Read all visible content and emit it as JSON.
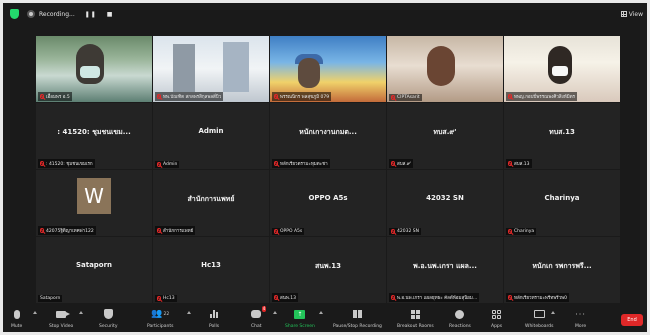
{
  "topbar": {
    "recording_label": "Recording...",
    "pause_label": "❚❚",
    "stop_label": "■",
    "view_label": "View"
  },
  "tiles": [
    {
      "name": "",
      "label": "เอื้อมพร อ.5",
      "muted": true
    },
    {
      "name": "",
      "label": "ทพ.บัณฑิต สกลพรสิกุลพลสี่บิว",
      "muted": true
    },
    {
      "name": "",
      "label": "พรรณนิกร พลสุขภูมิ 079",
      "muted": true
    },
    {
      "name": "",
      "label": "CIPTAsarit",
      "muted": true
    },
    {
      "name": "",
      "label": "ทพญ.กอบปี่พรรณพงศิวสิงห์มิตร",
      "muted": true
    },
    {
      "name": ": 41520: ชุมชนเขม...",
      "label": ": 41520: ชุมชนเขมเรก",
      "muted": true
    },
    {
      "name": "Admin",
      "label": "Admin",
      "muted": true
    },
    {
      "name": "หนักเกางานกมต...",
      "label": "หลักเรียวตรามะทุมตะชา",
      "muted": true
    },
    {
      "name": "ทบส.๙'",
      "label": "สบส.๙'",
      "muted": true
    },
    {
      "name": "ทบส.13",
      "label": "สบส.13",
      "muted": true
    },
    {
      "name": "",
      "label": "42075ฐิติญาเทคพ่า122",
      "muted": true,
      "avatar": "W"
    },
    {
      "name": "สำนักการแพทย์",
      "label": "สำนักการแพทย์",
      "muted": true
    },
    {
      "name": "OPPO A5s",
      "label": "OPPO A5s",
      "muted": true
    },
    {
      "name": "42032 SN",
      "label": "42032 SN",
      "muted": true
    },
    {
      "name": "Charinya",
      "label": "Charinya",
      "muted": true
    },
    {
      "name": "Sataporn",
      "label": "Sataporn",
      "muted": false
    },
    {
      "name": "Hc13",
      "label": "Hc13",
      "muted": true
    },
    {
      "name": "สนพ.13",
      "label": "สนพ.13",
      "muted": true
    },
    {
      "name": "พ.อ.นพ.เกรา แผล...",
      "label": "พ.อ.นพ.เกรา แผลยุทธะ คัลต์พ้อมสุนิยม...",
      "muted": true
    },
    {
      "name": "หนักเก รพการพรี...",
      "label": "หลักเรียวทรามะพรีทพรีวพ0",
      "muted": true
    }
  ],
  "toolbar": {
    "items": [
      {
        "key": "mute",
        "label": "Mute"
      },
      {
        "key": "video",
        "label": "Stop Video"
      },
      {
        "key": "security",
        "label": "Security"
      },
      {
        "key": "participants",
        "label": "Participants",
        "count": "22"
      },
      {
        "key": "polls",
        "label": "Polls"
      },
      {
        "key": "chat",
        "label": "Chat",
        "badge": "4"
      },
      {
        "key": "share",
        "label": "Share Screen"
      },
      {
        "key": "record",
        "label": "Pause/Stop Recording"
      },
      {
        "key": "breakout",
        "label": "Breakout Rooms"
      },
      {
        "key": "reactions",
        "label": "Reactions"
      },
      {
        "key": "apps",
        "label": "Apps"
      },
      {
        "key": "whiteboards",
        "label": "Whiteboards"
      },
      {
        "key": "more",
        "label": "More"
      }
    ],
    "end_label": "End"
  },
  "colors": {
    "window_bg": "#1a1a1a",
    "tile_bg": "#232323",
    "active_speaker": "#d6e51b",
    "muted_red": "#e02828",
    "share_green": "#23c45a",
    "end_red": "#e02828"
  }
}
